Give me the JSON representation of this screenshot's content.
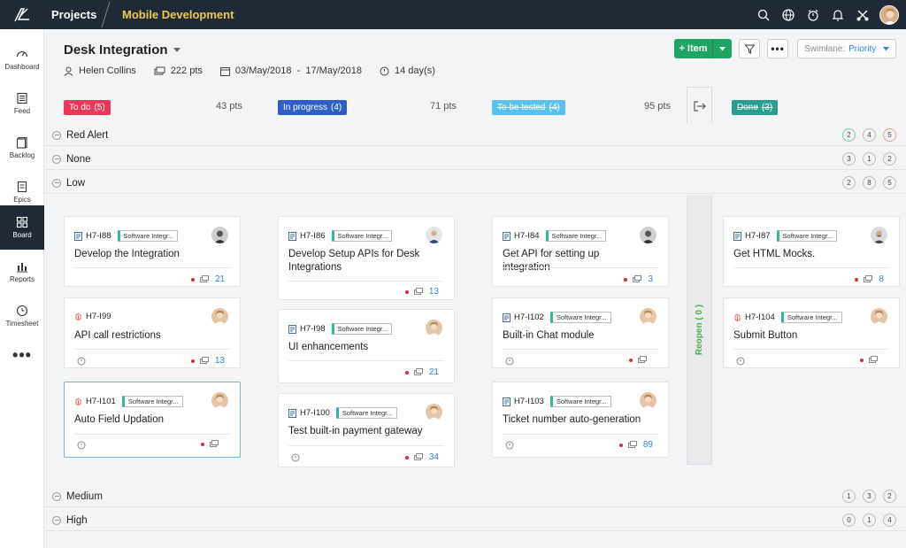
{
  "topbar": {
    "projects_label": "Projects",
    "project_name": "Mobile Development",
    "icons": [
      "search-icon",
      "globe-icon",
      "timer-icon",
      "bell-icon",
      "tools-icon"
    ]
  },
  "sidebar": {
    "items": [
      {
        "label": "Dashboard",
        "icon": "dashboard-icon"
      },
      {
        "label": "Feed",
        "icon": "feed-icon"
      },
      {
        "label": "Backlog",
        "icon": "backlog-icon"
      },
      {
        "label": "Epics",
        "icon": "epics-icon"
      },
      {
        "label": "Board",
        "icon": "board-icon",
        "active": true
      },
      {
        "label": "Reports",
        "icon": "reports-icon"
      },
      {
        "label": "Timesheet",
        "icon": "timesheet-icon"
      }
    ],
    "more_label": "•••"
  },
  "header": {
    "title": "Desk Integration",
    "owner": "Helen Collins",
    "points": "222 pts",
    "date_range": "03/May/2018  -  17/May/2018",
    "duration": "14 day(s)",
    "add_item_label": "+ Item",
    "more_label": "•••",
    "swimlane_label": "Swimlane:",
    "swimlane_value": "Priority"
  },
  "columns": [
    {
      "name": "To do",
      "count": "(5)",
      "points": "43 pts",
      "color": "#e8395a"
    },
    {
      "name": "In progress",
      "count": "(4)",
      "points": "71 pts",
      "color": "#2f5fc4"
    },
    {
      "name": "To be tested",
      "count": "(4)",
      "points": "95 pts",
      "color": "#5bc0eb"
    },
    {
      "name": "Done",
      "count": "(3)",
      "points": "",
      "color": "#2a9d8f"
    }
  ],
  "lanes": {
    "red_alert": {
      "name": "Red Alert",
      "counts": [
        "2",
        "4",
        "5"
      ]
    },
    "none": {
      "name": "None",
      "counts": [
        "3",
        "1",
        "2"
      ]
    },
    "low": {
      "name": "Low",
      "counts": [
        "2",
        "8",
        "5"
      ]
    },
    "medium": {
      "name": "Medium",
      "counts": [
        "1",
        "3",
        "2"
      ]
    },
    "high": {
      "name": "High",
      "counts": [
        "0",
        "1",
        "4"
      ]
    }
  },
  "reopen_label": "Reopen ( 0 )",
  "cards": {
    "c1": {
      "id": "H7-I88",
      "tag": "Software Integr...",
      "title": "Develop the Integration",
      "comments": "21"
    },
    "c2": {
      "id": "H7-I99",
      "tag": "",
      "title": "API call restrictions",
      "comments": "13"
    },
    "c3": {
      "id": "H7-I101",
      "tag": "Software Integr...",
      "title": "Auto Field Updation",
      "comments": ""
    },
    "c4": {
      "id": "H7-I86",
      "tag": "Software Integr...",
      "title": "Develop Setup APIs for Desk Integrations",
      "comments": "13"
    },
    "c5": {
      "id": "H7-I98",
      "tag": "Software Integr...",
      "title": "UI enhancements",
      "comments": "21"
    },
    "c6": {
      "id": "H7-I100",
      "tag": "Software Integr...",
      "title": "Test built-in payment gateway",
      "comments": "34"
    },
    "c7": {
      "id": "H7-I84",
      "tag": "Software Integr...",
      "title": "Get API for setting up integration",
      "comments": "3"
    },
    "c8": {
      "id": "H7-I102",
      "tag": "Software Integr...",
      "title": "Built-in Chat module",
      "comments": ""
    },
    "c9": {
      "id": "H7-I103",
      "tag": "Software Integr...",
      "title": "Ticket number auto-generation",
      "comments": "89"
    },
    "c10": {
      "id": "H7-I87",
      "tag": "Software Integr...",
      "title": "Get HTML Mocks.",
      "comments": "8"
    },
    "c11": {
      "id": "H7-I104",
      "tag": "Software Integr...",
      "title": "Submit Button",
      "comments": ""
    }
  }
}
